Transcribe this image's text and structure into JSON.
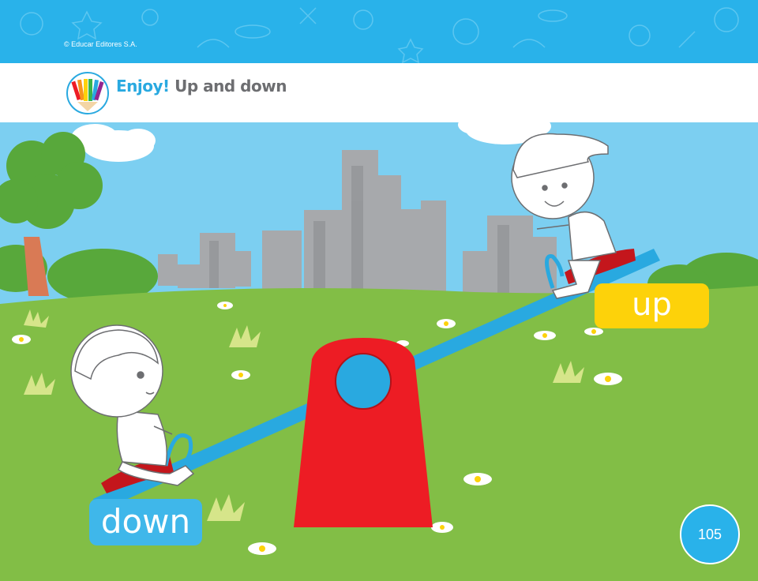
{
  "header": {
    "copyright": "© Educar Editores S.A.",
    "title_accent": "Enjoy!",
    "title_text": "Up and down",
    "logo_icon": "colored-pencils-icon"
  },
  "scene": {
    "label_up": "up",
    "label_down": "down"
  },
  "footer": {
    "page_number": "105"
  },
  "colors": {
    "header_band": "#29b2ea",
    "title_accent": "#29a9e0",
    "sky": "#7ccff1",
    "grass": "#82be46",
    "seesaw_base": "#ed1c24",
    "seesaw_board": "#29a9e0",
    "label_up": "#fdd20a",
    "label_down": "#3fb7ea"
  }
}
